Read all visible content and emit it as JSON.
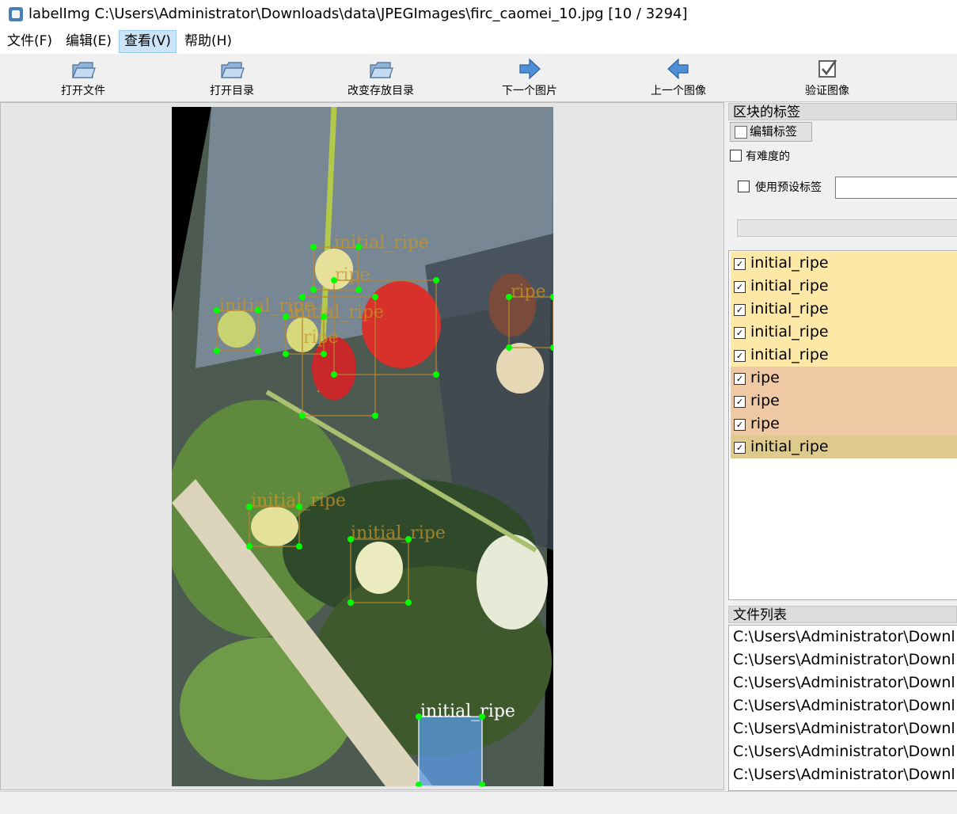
{
  "window": {
    "title": "labelImg C:\\Users\\Administrator\\Downloads\\data\\JPEGImages\\firc_caomei_10.jpg [10 / 3294]"
  },
  "menu": {
    "items": [
      "文件(F)",
      "编辑(E)",
      "查看(V)",
      "帮助(H)"
    ],
    "active": "查看(V)"
  },
  "toolbar": {
    "open_file": "打开文件",
    "open_dir": "打开目录",
    "change_save_dir": "改变存放目录",
    "next_image": "下一个图片",
    "prev_image": "上一个图像",
    "verify_image": "验证图像"
  },
  "icons": {
    "open_file": "folder-icon",
    "open_dir": "folder-icon",
    "change_save_dir": "folder-icon",
    "next_image": "arrow-right-icon",
    "prev_image": "arrow-left-icon",
    "verify_image": "checkbox-icon",
    "edit_label": "edit-icon"
  },
  "canvas": {
    "boxes": [
      {
        "label": "initial_ripe",
        "selected": false
      },
      {
        "label": "initial_ripe",
        "selected": false
      },
      {
        "label": "initial_ripe",
        "selected": false
      },
      {
        "label": "initial_ripe",
        "selected": false
      },
      {
        "label": "initial_ripe",
        "selected": false
      },
      {
        "label": "ripe",
        "selected": false
      },
      {
        "label": "ripe",
        "selected": false
      },
      {
        "label": "ripe",
        "selected": false
      },
      {
        "label": "initial_ripe",
        "selected": true
      }
    ]
  },
  "dock": {
    "box_labels_title": "区块的标签",
    "edit_label_button": "编辑标签",
    "difficult_label": "有难度的",
    "difficult_checked": false,
    "use_default_label": "使用预设标签",
    "use_default_checked": false,
    "default_label_value": "",
    "labels": [
      {
        "text": "initial_ripe",
        "checked": true,
        "color": "#fde8a8"
      },
      {
        "text": "initial_ripe",
        "checked": true,
        "color": "#fde8a8"
      },
      {
        "text": "initial_ripe",
        "checked": true,
        "color": "#fde8a8"
      },
      {
        "text": "initial_ripe",
        "checked": true,
        "color": "#fde8a8"
      },
      {
        "text": "initial_ripe",
        "checked": true,
        "color": "#fde8a8"
      },
      {
        "text": "ripe",
        "checked": true,
        "color": "#efc8a4"
      },
      {
        "text": "ripe",
        "checked": true,
        "color": "#efc8a4"
      },
      {
        "text": "ripe",
        "checked": true,
        "color": "#efc8a4"
      },
      {
        "text": "initial_ripe",
        "checked": true,
        "color": "#ddca8c"
      }
    ],
    "file_list_title": "文件列表",
    "files": [
      "C:\\Users\\Administrator\\Downl",
      "C:\\Users\\Administrator\\Downl",
      "C:\\Users\\Administrator\\Downl",
      "C:\\Users\\Administrator\\Downl",
      "C:\\Users\\Administrator\\Downl",
      "C:\\Users\\Administrator\\Downl",
      "C:\\Users\\Administrator\\Downl"
    ]
  },
  "colors": {
    "box_outline": "#b7862e",
    "box_label_text": "#c8962a",
    "vertex": "#00ff00",
    "selected_fill": "#5a9be6",
    "selected_label_text": "#ffffff"
  }
}
